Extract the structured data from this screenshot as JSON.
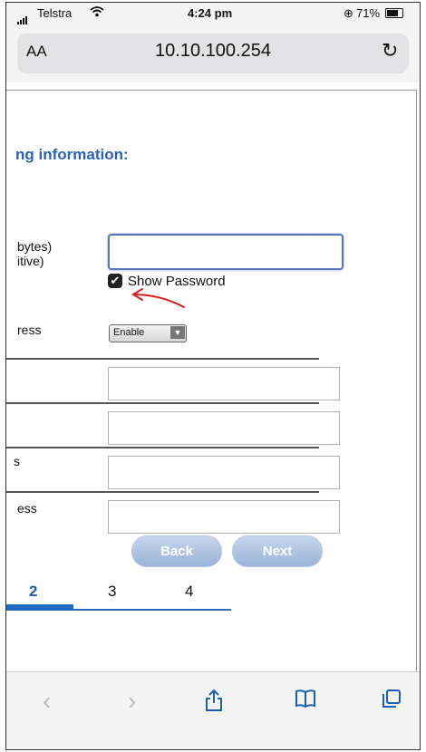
{
  "status_bar": {
    "carrier": "Telstra",
    "time": "4:24 pm",
    "battery": "71%"
  },
  "address_bar": {
    "text_size_label": "AA",
    "url": "10.10.100.254"
  },
  "form": {
    "heading": "ng information:",
    "key_length_label_line1": "bytes)",
    "key_length_label_line2": "itive)",
    "password_value": "",
    "show_password_label": "Show Password",
    "show_password_checked": true,
    "address_label_1": "ress",
    "enable_select_value": "Enable",
    "field_label_3": "s",
    "address_label_2": "ess"
  },
  "buttons": {
    "back": "Back",
    "next": "Next"
  },
  "steps": {
    "current": "2",
    "items": [
      "2",
      "3",
      "4"
    ]
  },
  "colors": {
    "accent": "#1a5fb4",
    "heading": "#2a60b6",
    "annotation": "#d42020"
  },
  "toolbar": {
    "icons": [
      "chevron-left",
      "chevron-right",
      "share",
      "bookmarks",
      "tabs"
    ]
  }
}
